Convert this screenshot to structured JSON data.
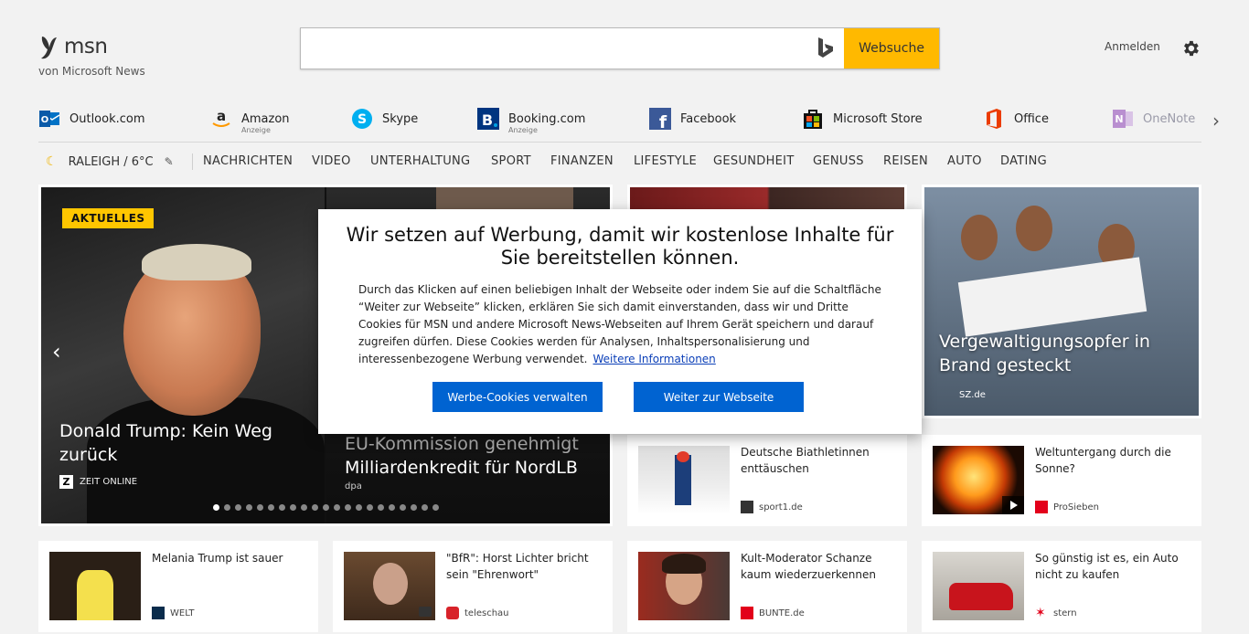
{
  "brand": {
    "name": "msn",
    "tagline": "von Microsoft News"
  },
  "search": {
    "placeholder": "",
    "value": "",
    "button_label": "Websuche",
    "engine_icon": "bing-icon"
  },
  "header": {
    "signin_label": "Anmelden",
    "settings_icon": "gear-icon"
  },
  "quicklinks": [
    {
      "label": "Outlook.com",
      "sub": "",
      "icon": "outlook-icon",
      "color": "#0072c6"
    },
    {
      "label": "Amazon",
      "sub": "Anzeige",
      "icon": "amazon-icon",
      "color": "#f90"
    },
    {
      "label": "Skype",
      "sub": "",
      "icon": "skype-icon",
      "color": "#00aff0"
    },
    {
      "label": "Booking.com",
      "sub": "Anzeige",
      "icon": "booking-icon",
      "color": "#003580"
    },
    {
      "label": "Facebook",
      "sub": "",
      "icon": "facebook-icon",
      "color": "#3b5998"
    },
    {
      "label": "Microsoft Store",
      "sub": "",
      "icon": "microsoft-store-icon",
      "color": "#111111"
    },
    {
      "label": "Office",
      "sub": "",
      "icon": "office-icon",
      "color": "#eb3c00"
    },
    {
      "label": "OneNote",
      "sub": "",
      "icon": "onenote-icon",
      "color": "#7719aa"
    }
  ],
  "weather": {
    "label": "RALEIGH / 6°C"
  },
  "nav": [
    "NACHRICHTEN",
    "VIDEO",
    "UNTERHALTUNG",
    "SPORT",
    "FINANZEN",
    "LIFESTYLE",
    "GESUNDHEIT",
    "GENUSS",
    "REISEN",
    "AUTO",
    "DATING"
  ],
  "hero": {
    "badge": "AKTUELLES",
    "title": "Donald Trump: Kein Weg zurück",
    "source": "ZEIT ONLINE",
    "side_title_1": "EU-Kommission genehmigt",
    "side_title_2": "Milliardenkredit für NordLB",
    "side_source": "dpa",
    "dot_count": 21,
    "active_dot": 0
  },
  "tile_right": {
    "title": "Vergewaltigungsopfer in Brand gesteckt",
    "source": "SZ.de"
  },
  "cards": [
    {
      "title": "Deutsche Biathletinnen enttäuschen",
      "source": "sport1.de",
      "src_color": "#333333"
    },
    {
      "title": "Weltuntergang durch die Sonne?",
      "source": "ProSieben",
      "src_color": "#e3001b"
    },
    {
      "title": "Melania Trump ist sauer",
      "source": "WELT",
      "src_color": "#0a2c4c"
    },
    {
      "title": "\"BfR\": Horst Lichter bricht sein \"Ehrenwort\"",
      "source": "teleschau",
      "src_color": "#d8232a"
    },
    {
      "title": "Kult-Moderator Schanze kaum wiederzuerkennen",
      "source": "BUNTE.de",
      "src_color": "#e2001a"
    },
    {
      "title": "So günstig ist es, ein Auto nicht zu kaufen",
      "source": "stern",
      "src_color": "#e2001a"
    }
  ],
  "modal": {
    "title": "Wir setzen auf Werbung, damit wir kostenlose Inhalte für Sie bereitstellen können.",
    "body": "Durch das Klicken auf einen beliebigen Inhalt der Webseite oder indem Sie auf die Schaltfläche “Weiter zur Webseite” klicken, erklären Sie sich damit einverstanden, dass wir und Dritte Cookies für MSN und andere Microsoft News-Webseiten auf Ihrem Gerät speichern und darauf zugreifen dürfen. Diese Cookies werden für Analysen, Inhaltspersonalisierung und interessenbezogene Werbung verwendet.",
    "link": "Weitere Informationen",
    "btn_manage": "Werbe-Cookies verwalten",
    "btn_continue": "Weiter zur Webseite"
  },
  "colors": {
    "accent": "#ffb900",
    "button_blue": "#0063d1",
    "badge_yellow": "#ffc600"
  }
}
